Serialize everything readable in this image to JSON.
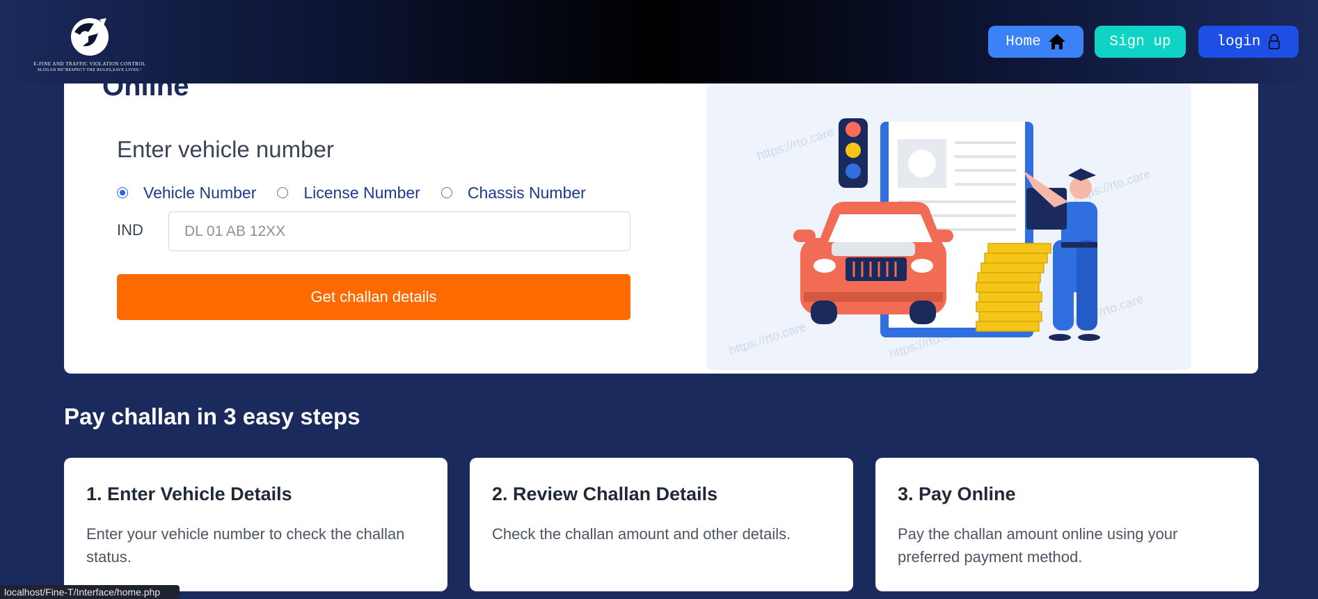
{
  "logo": {
    "title": "E-FINE AND TRAFFIC VIOLATION CONTROL",
    "slogan": "SLOGAN HE\"RESPECT THE RULES,SAVE LIVES.\""
  },
  "nav": {
    "home_label": "Home",
    "signup_label": "Sign up",
    "login_label": "login"
  },
  "search": {
    "title_partial": "Online",
    "heading": "Enter vehicle number",
    "options": [
      {
        "label": "Vehicle Number",
        "checked": true
      },
      {
        "label": "License Number",
        "checked": false
      },
      {
        "label": "Chassis Number",
        "checked": false
      }
    ],
    "country_prefix": "IND",
    "placeholder": "DL 01 AB 12XX",
    "submit_label": "Get challan details",
    "watermark": "https://rto.care"
  },
  "steps": {
    "heading": "Pay challan in 3 easy steps",
    "items": [
      {
        "title": "1. Enter Vehicle Details",
        "desc": "Enter your vehicle number to check the challan status."
      },
      {
        "title": "2. Review Challan Details",
        "desc": "Check the challan amount and other details."
      },
      {
        "title": "3. Pay Online",
        "desc": "Pay the challan amount online using your preferred payment method."
      }
    ]
  },
  "status_bar": {
    "url": "localhost/Fine-T/Interface/home.php"
  },
  "colors": {
    "page_bg": "#1b2a5c",
    "home_btn": "#3b82f6",
    "signup_btn": "#0fd3c4",
    "login_btn": "#1d4fe6",
    "cta": "#ff6a00"
  },
  "icons": {
    "home": "home-icon",
    "login": "lock-icon"
  }
}
